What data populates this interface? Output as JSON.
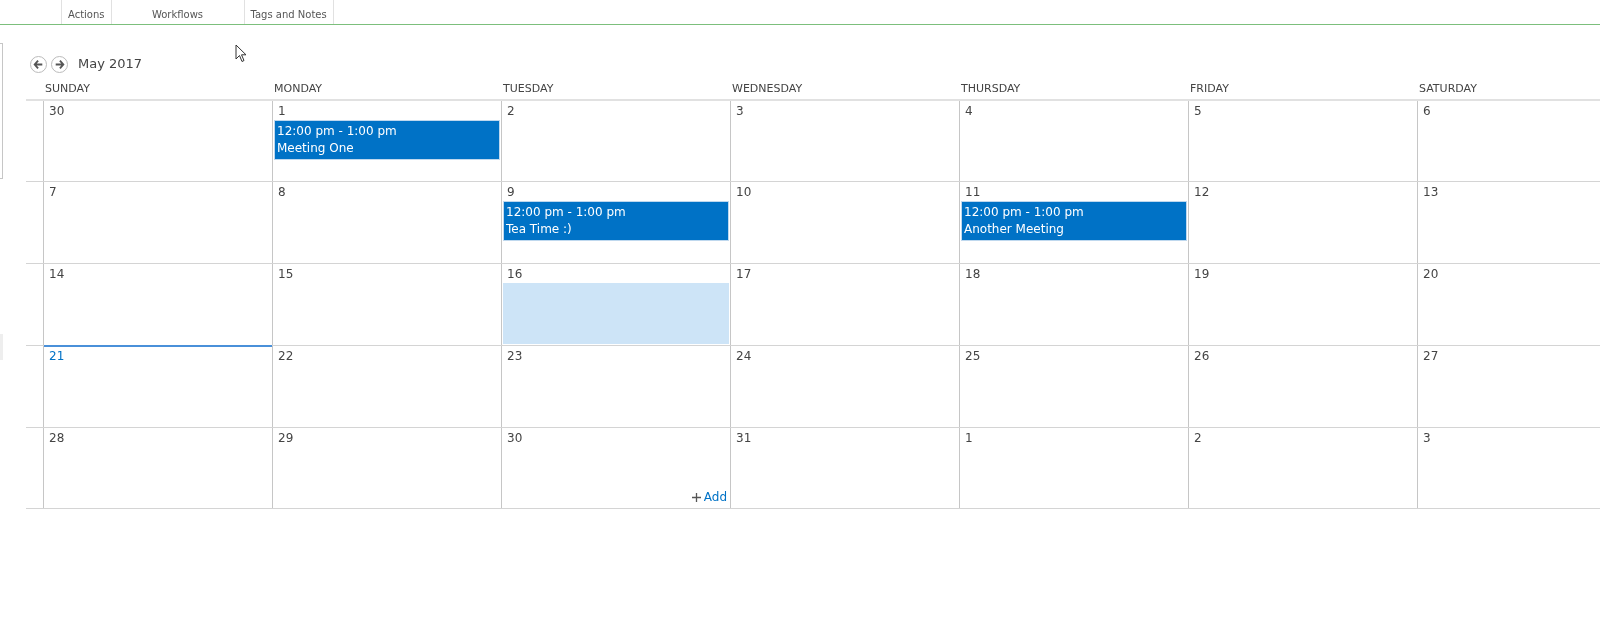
{
  "ribbon": {
    "groups": [
      "Actions",
      "Workflows",
      "Tags and Notes"
    ]
  },
  "navigation": {
    "month": "May 2017"
  },
  "weekdays": [
    "SUNDAY",
    "MONDAY",
    "TUESDAY",
    "WEDNESDAY",
    "THURSDAY",
    "FRIDAY",
    "SATURDAY"
  ],
  "weeks": [
    {
      "days": [
        {
          "day": "30",
          "today": false,
          "selected": false
        },
        {
          "day": "1",
          "today": false,
          "selected": false,
          "events": [
            {
              "time": "12:00 pm - 1:00 pm",
              "title": "Meeting One"
            }
          ]
        },
        {
          "day": "2",
          "today": false,
          "selected": false
        },
        {
          "day": "3",
          "today": false,
          "selected": false
        },
        {
          "day": "4",
          "today": false,
          "selected": false
        },
        {
          "day": "5",
          "today": false,
          "selected": false
        },
        {
          "day": "6",
          "today": false,
          "selected": false
        }
      ]
    },
    {
      "days": [
        {
          "day": "7",
          "today": false,
          "selected": false
        },
        {
          "day": "8",
          "today": false,
          "selected": false
        },
        {
          "day": "9",
          "today": false,
          "selected": false,
          "events": [
            {
              "time": "12:00 pm - 1:00 pm",
              "title": "Tea Time :)"
            }
          ]
        },
        {
          "day": "10",
          "today": false,
          "selected": false
        },
        {
          "day": "11",
          "today": false,
          "selected": false,
          "events": [
            {
              "time": "12:00 pm - 1:00 pm",
              "title": "Another Meeting"
            }
          ]
        },
        {
          "day": "12",
          "today": false,
          "selected": false
        },
        {
          "day": "13",
          "today": false,
          "selected": false
        }
      ]
    },
    {
      "days": [
        {
          "day": "14",
          "today": false,
          "selected": false
        },
        {
          "day": "15",
          "today": false,
          "selected": false
        },
        {
          "day": "16",
          "today": false,
          "selected": true
        },
        {
          "day": "17",
          "today": false,
          "selected": false
        },
        {
          "day": "18",
          "today": false,
          "selected": false
        },
        {
          "day": "19",
          "today": false,
          "selected": false
        },
        {
          "day": "20",
          "today": false,
          "selected": false
        }
      ]
    },
    {
      "days": [
        {
          "day": "21",
          "today": true,
          "selected": false
        },
        {
          "day": "22",
          "today": false,
          "selected": false
        },
        {
          "day": "23",
          "today": false,
          "selected": false
        },
        {
          "day": "24",
          "today": false,
          "selected": false
        },
        {
          "day": "25",
          "today": false,
          "selected": false
        },
        {
          "day": "26",
          "today": false,
          "selected": false
        },
        {
          "day": "27",
          "today": false,
          "selected": false
        }
      ]
    },
    {
      "days": [
        {
          "day": "28",
          "today": false,
          "selected": false
        },
        {
          "day": "29",
          "today": false,
          "selected": false
        },
        {
          "day": "30",
          "today": false,
          "selected": false,
          "add_link": "Add"
        },
        {
          "day": "31",
          "today": false,
          "selected": false
        },
        {
          "day": "1",
          "today": false,
          "selected": false
        },
        {
          "day": "2",
          "today": false,
          "selected": false
        },
        {
          "day": "3",
          "today": false,
          "selected": false
        }
      ]
    }
  ]
}
